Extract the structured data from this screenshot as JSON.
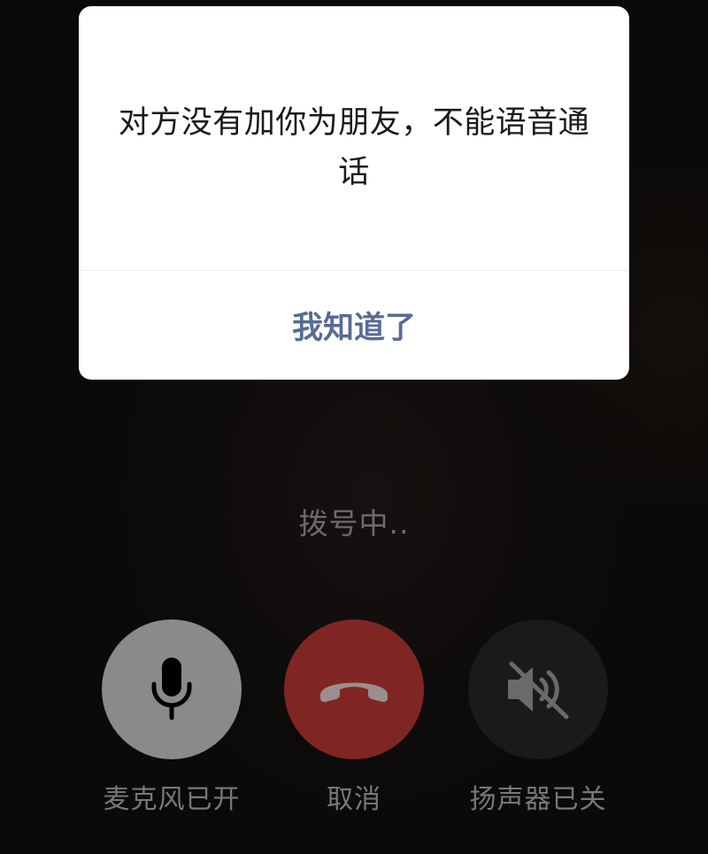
{
  "dialog": {
    "message": "对方没有加你为朋友，不能语音通话",
    "confirm_label": "我知道了"
  },
  "call": {
    "status": "拨号中.."
  },
  "controls": {
    "mic_label": "麦克风已开",
    "cancel_label": "取消",
    "speaker_label": "扬声器已关"
  },
  "icons": {
    "mic": "microphone-icon",
    "hangup": "phone-hangup-icon",
    "speaker": "speaker-muted-icon"
  },
  "colors": {
    "accent_link": "#576b95",
    "hangup_red": "#7f2624",
    "mic_button": "#8b8a8a",
    "speaker_button": "#1b1a1a"
  }
}
